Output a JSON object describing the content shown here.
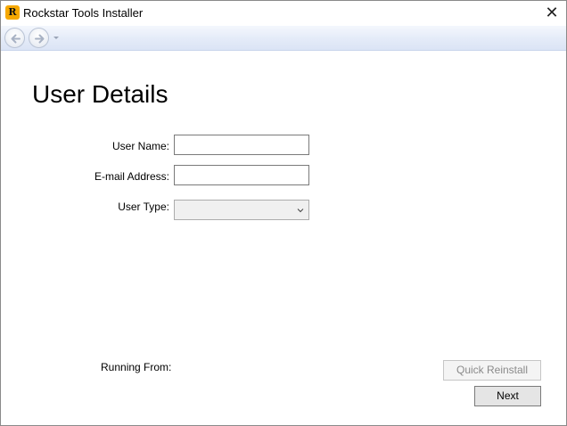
{
  "window": {
    "title": "Rockstar Tools Installer",
    "app_icon_glyph": "R",
    "close_glyph": "✕"
  },
  "page": {
    "heading": "User Details"
  },
  "form": {
    "user_name_label": "User Name:",
    "user_name_value": "",
    "email_label": "E-mail Address:",
    "email_value": "",
    "user_type_label": "User Type:",
    "user_type_value": ""
  },
  "footer": {
    "running_from_label": "Running From:",
    "quick_reinstall_label": "Quick Reinstall",
    "next_label": "Next"
  },
  "icons": {
    "app": "rockstar-logo-icon",
    "close": "close-icon",
    "back": "back-arrow-icon",
    "forward": "forward-arrow-icon",
    "history": "chevron-down-icon"
  },
  "colors": {
    "app_icon": "#f6a800",
    "nav_gradient_top": "#f4f7fd",
    "nav_gradient_bottom": "#dbe4f5",
    "disabled_text": "#8a8a8a"
  }
}
